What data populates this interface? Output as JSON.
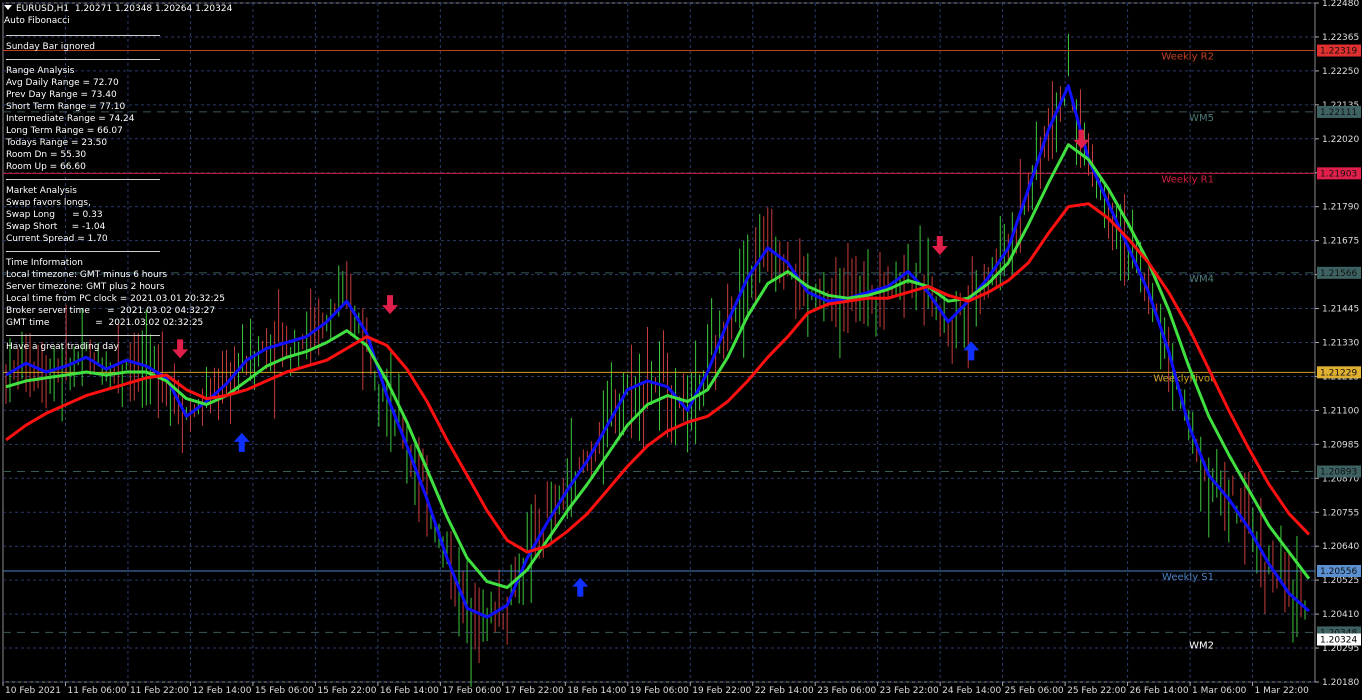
{
  "header": {
    "symbol": "EURUSD,H1",
    "ohlc": "1.20271 1.20348 1.20264 1.20324",
    "indicator": "Auto Fibonacci"
  },
  "info_panel": {
    "sunday_bar": "Sunday Bar ignored",
    "range_title": "Range Analysis",
    "range_lines": [
      "Avg Daily Range = 72.70",
      "Prev Day Range = 73.40",
      "Short Term Range = 77.10",
      "Intermediate Range = 74.24",
      "Long Term Range = 66.07",
      "Todays Range = 23.50",
      "Room Dn = 55.30",
      "Room Up = 66.60"
    ],
    "market_title": "Market Analysis",
    "market_lines": [
      "Swap favors longs,",
      "Swap Long      = 0.33",
      "Swap Short     = -1.04",
      "Current Spread = 1.70"
    ],
    "time_title": "Time Information",
    "time_lines": [
      "Local timezone: GMT minus 6 hours",
      "Server timezone: GMT plus 2 hours",
      "Local time from PC clock = 2021.03.01 20:32:25",
      "Broker server time      =  2021.03.02 04:32:27",
      "GMT time                =  2021.03.02 02:32:25"
    ],
    "greeting": "Have a great trading day"
  },
  "price_scale": [
    "1.22480",
    "1.22365",
    "1.22250",
    "1.22135",
    "1.22020",
    "1.21905",
    "1.21790",
    "1.21675",
    "1.21560",
    "1.21445",
    "1.21330",
    "1.21215",
    "1.21100",
    "1.20985",
    "1.20870",
    "1.20755",
    "1.20640",
    "1.20525",
    "1.20410",
    "1.20295",
    "1.20180"
  ],
  "time_scale": [
    "10 Feb 2021",
    "11 Feb 06:00",
    "11 Feb 22:00",
    "12 Feb 14:00",
    "15 Feb 06:00",
    "15 Feb 22:00",
    "16 Feb 14:00",
    "17 Feb 06:00",
    "17 Feb 22:00",
    "18 Feb 14:00",
    "19 Feb 06:00",
    "19 Feb 22:00",
    "22 Feb 14:00",
    "23 Feb 06:00",
    "23 Feb 22:00",
    "24 Feb 14:00",
    "25 Feb 06:00",
    "25 Feb 22:00",
    "26 Feb 14:00",
    "1 Mar 06:00",
    "1 Mar 22:00"
  ],
  "levels": [
    {
      "name": "Weekly R2",
      "price": 1.22319,
      "tag": "1.22319",
      "color": "#c04020",
      "tagbg": "#e03030",
      "style": "solid"
    },
    {
      "name": "WM5",
      "price": 1.22111,
      "tag": "1.22111",
      "color": "#3a5a5a",
      "tagbg": "#3e6262",
      "style": "dash"
    },
    {
      "name": "Weekly R1",
      "price": 1.21903,
      "tag": "1.21903",
      "color": "#d02040",
      "tagbg": "#e0204a",
      "style": "solid"
    },
    {
      "name": "WM4",
      "price": 1.21566,
      "tag": "1.21566",
      "color": "#3a5a5a",
      "tagbg": "#3e6262",
      "style": "dash"
    },
    {
      "name": "WeeklyPivot",
      "price": 1.21229,
      "tag": "1.21229",
      "color": "#d0a020",
      "tagbg": "#e0b030",
      "style": "solid"
    },
    {
      "name": "",
      "price": 1.20893,
      "tag": "1.20893",
      "color": "#3a5a5a",
      "tagbg": "#3e6262",
      "style": "dash"
    },
    {
      "name": "Weekly S1",
      "price": 1.20556,
      "tag": "1.20556",
      "color": "#4a80c0",
      "tagbg": "#5a90d0",
      "style": "solid"
    },
    {
      "name": "",
      "price": 1.20348,
      "tag": "1.20348",
      "color": "#3a5a5a",
      "tagbg": "#3e6262",
      "style": "dash"
    },
    {
      "name": "WM2",
      "price": 1.20324,
      "tag": "1.20324",
      "color": "#ffffff",
      "tagbg": "#ffffff",
      "style": "none"
    }
  ],
  "chart_data": {
    "type": "line",
    "ylim": [
      1.2018,
      1.2248
    ],
    "grid": true,
    "series": [
      {
        "color": "#1010ff",
        "values": [
          1.2122,
          1.2126,
          1.2123,
          1.2125,
          1.2128,
          1.2124,
          1.2127,
          1.2125,
          1.2121,
          1.2108,
          1.2113,
          1.2119,
          1.2127,
          1.2131,
          1.2133,
          1.2135,
          1.214,
          1.2147,
          1.2136,
          1.2115,
          1.2098,
          1.208,
          1.206,
          1.2043,
          1.204,
          1.2044,
          1.206,
          1.2072,
          1.2083,
          1.2093,
          1.2105,
          1.2117,
          1.212,
          1.2118,
          1.211,
          1.2123,
          1.214,
          1.2155,
          1.2165,
          1.216,
          1.215,
          1.2147,
          1.2148,
          1.215,
          1.2152,
          1.2157,
          1.215,
          1.214,
          1.2147,
          1.2155,
          1.2165,
          1.2185,
          1.2205,
          1.222,
          1.2195,
          1.218,
          1.2165,
          1.215,
          1.213,
          1.2105,
          1.2088,
          1.208,
          1.207,
          1.2058,
          1.2048,
          1.2042
        ]
      },
      {
        "color": "#40e040",
        "values": [
          1.2118,
          1.212,
          1.2121,
          1.2122,
          1.2123,
          1.2122,
          1.2123,
          1.2123,
          1.212,
          1.2114,
          1.2112,
          1.2115,
          1.212,
          1.2125,
          1.2128,
          1.213,
          1.2133,
          1.2137,
          1.2132,
          1.212,
          1.2106,
          1.209,
          1.2074,
          1.206,
          1.2052,
          1.205,
          1.2056,
          1.2066,
          1.2076,
          1.2085,
          1.2095,
          1.2105,
          1.2112,
          1.2115,
          1.2113,
          1.2117,
          1.2128,
          1.2142,
          1.2153,
          1.2157,
          1.2152,
          1.2149,
          1.2148,
          1.2149,
          1.2151,
          1.2154,
          1.2152,
          1.2147,
          1.2148,
          1.2153,
          1.216,
          1.2173,
          1.2187,
          1.22,
          1.2195,
          1.2185,
          1.2173,
          1.216,
          1.2144,
          1.2125,
          1.2108,
          1.2095,
          1.2083,
          1.2071,
          1.2062,
          1.2053
        ]
      },
      {
        "color": "#ff1010",
        "values": [
          1.21,
          1.2105,
          1.2109,
          1.2112,
          1.2115,
          1.2117,
          1.2119,
          1.2121,
          1.2122,
          1.2117,
          1.2114,
          1.2115,
          1.2117,
          1.212,
          1.2123,
          1.2125,
          1.2127,
          1.2131,
          1.2135,
          1.2132,
          1.2124,
          1.2113,
          1.21,
          1.2088,
          1.2076,
          1.2066,
          1.2062,
          1.2064,
          1.2069,
          1.2075,
          1.2083,
          1.2091,
          1.2098,
          1.2103,
          1.2106,
          1.2108,
          1.2113,
          1.212,
          1.2128,
          1.2135,
          1.2143,
          1.2146,
          1.2147,
          1.2148,
          1.2148,
          1.215,
          1.2152,
          1.2149,
          1.2147,
          1.215,
          1.2154,
          1.216,
          1.217,
          1.2179,
          1.218,
          1.2175,
          1.2168,
          1.216,
          1.215,
          1.2138,
          1.2124,
          1.211,
          1.2097,
          1.2085,
          1.2075,
          1.2068
        ]
      }
    ]
  },
  "arrows": [
    {
      "type": "down",
      "color": "#e0204a",
      "x": 0.135,
      "price": 1.213
    },
    {
      "type": "up",
      "color": "#1030ff",
      "x": 0.182,
      "price": 1.21
    },
    {
      "type": "down",
      "color": "#e0204a",
      "x": 0.295,
      "price": 1.2145
    },
    {
      "type": "up",
      "color": "#1030ff",
      "x": 0.44,
      "price": 1.2051
    },
    {
      "type": "down",
      "color": "#e0204a",
      "x": 0.714,
      "price": 1.2165
    },
    {
      "type": "up",
      "color": "#1030ff",
      "x": 0.738,
      "price": 1.2131
    },
    {
      "type": "down",
      "color": "#e0204a",
      "x": 0.822,
      "price": 1.2201
    }
  ]
}
